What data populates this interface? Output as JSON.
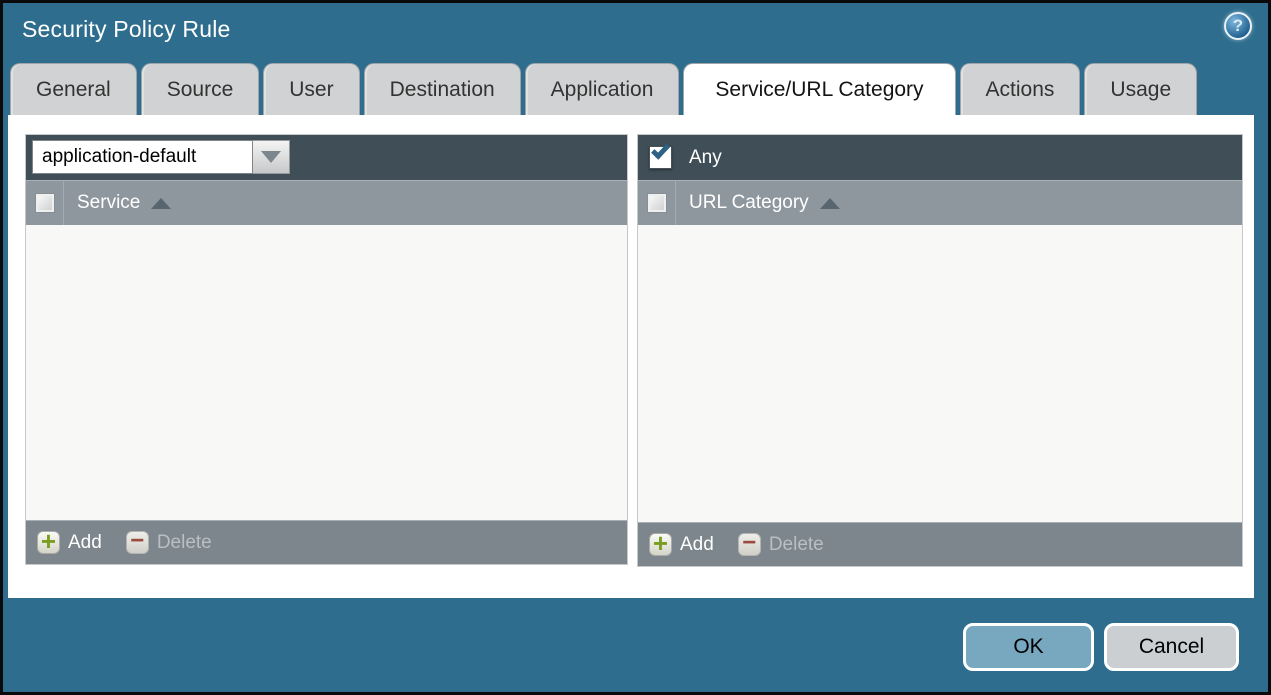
{
  "dialog": {
    "title": "Security Policy Rule"
  },
  "icons": {
    "help": "?",
    "plus": "+",
    "minus": "−",
    "check": "✓",
    "dropdown_arrow": "▼",
    "sort_ascending": "▲"
  },
  "tabs": [
    {
      "label": "General",
      "active": false
    },
    {
      "label": "Source",
      "active": false
    },
    {
      "label": "User",
      "active": false
    },
    {
      "label": "Destination",
      "active": false
    },
    {
      "label": "Application",
      "active": false
    },
    {
      "label": "Service/URL Category",
      "active": true
    },
    {
      "label": "Actions",
      "active": false
    },
    {
      "label": "Usage",
      "active": false
    }
  ],
  "service_panel": {
    "dropdown_value": "application-default",
    "column_header": "Service",
    "sort_order": "ascending",
    "select_all_checked": false,
    "rows": [],
    "add_label": "Add",
    "delete_label": "Delete",
    "delete_enabled": false
  },
  "url_category_panel": {
    "any_label": "Any",
    "any_checked": true,
    "column_header": "URL Category",
    "sort_order": "ascending",
    "select_all_checked": false,
    "rows": [],
    "add_label": "Add",
    "delete_label": "Delete",
    "delete_enabled": false
  },
  "buttons": {
    "ok": "OK",
    "cancel": "Cancel"
  },
  "colors": {
    "dialog_background": "#2e6d8d",
    "dark_header": "#3f4e57",
    "column_header": "#8e979e",
    "footer_bar": "#7d868d",
    "ok_button": "#78a8c0",
    "cancel_button": "#cbcfd2",
    "add_plus": "#7a9e1f",
    "delete_minus": "#9c4a3e",
    "checkmark": "#2d6285"
  }
}
